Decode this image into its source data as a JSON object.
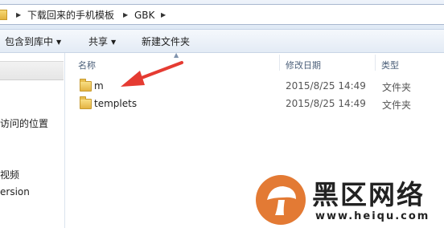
{
  "address_bar": {
    "crumbs": [
      "下载回来的手机模板",
      "GBK"
    ]
  },
  "toolbar": {
    "include_in_library": "包含到库中",
    "share": "共享",
    "new_folder": "新建文件夹"
  },
  "nav_pane": {
    "items": [
      "访问的位置",
      "视频",
      "ersion"
    ]
  },
  "columns": {
    "name": "名称",
    "date_modified": "修改日期",
    "type": "类型"
  },
  "files": [
    {
      "name": "m",
      "date": "2015/8/25 14:49",
      "type": "文件夹",
      "icon": "folder-icon"
    },
    {
      "name": "templets",
      "date": "2015/8/25 14:49",
      "type": "文件夹",
      "icon": "folder-icon"
    }
  ],
  "annotation": {
    "color": "#e53b32"
  },
  "watermark": {
    "title": "黑区网络",
    "url": "www.heiqu.com",
    "logo_color": "#e37a34"
  }
}
